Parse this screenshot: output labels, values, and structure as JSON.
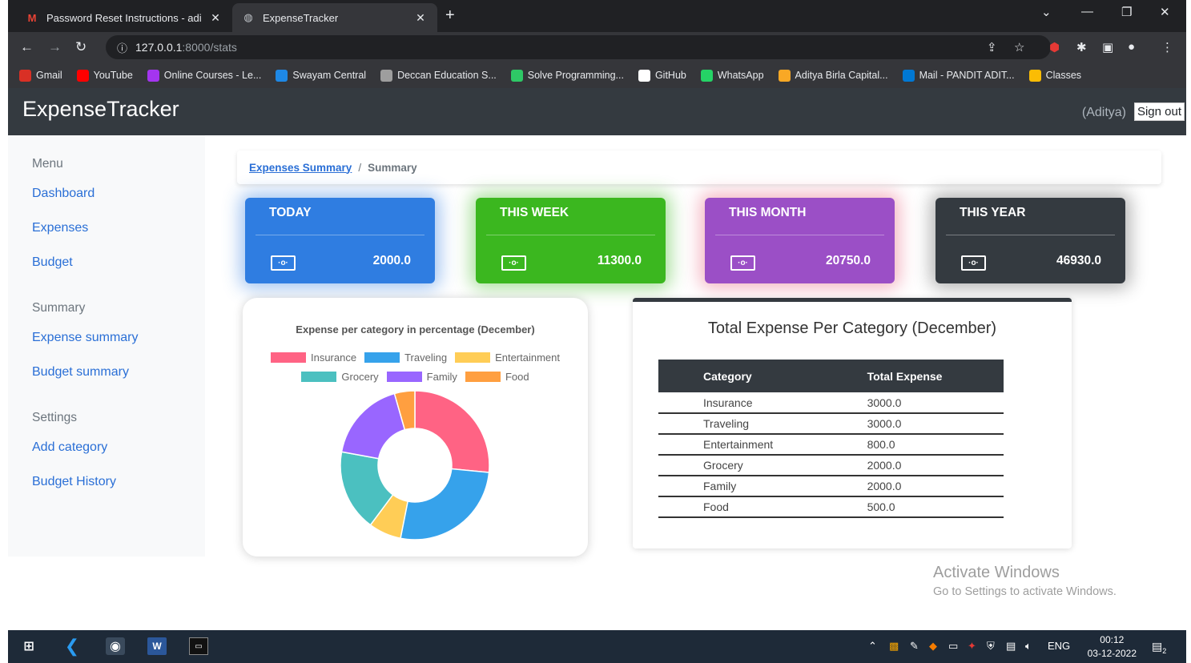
{
  "browser": {
    "tabs": [
      {
        "title": "Password Reset Instructions - adi",
        "favicon": "gmail-icon",
        "active": false
      },
      {
        "title": "ExpenseTracker",
        "favicon": "globe-icon",
        "active": true
      }
    ],
    "url_host": "127.0.0.1",
    "url_path": ":8000/stats",
    "bookmarks": [
      {
        "label": "Gmail",
        "icon": "gmail-icon",
        "color": "#d93025"
      },
      {
        "label": "YouTube",
        "icon": "youtube-icon",
        "color": "#ff0000"
      },
      {
        "label": "Online Courses - Le...",
        "icon": "udemy-icon",
        "color": "#a435f0"
      },
      {
        "label": "Swayam Central",
        "icon": "swayam-icon",
        "color": "#1e88e5"
      },
      {
        "label": "Deccan Education S...",
        "icon": "deccan-icon",
        "color": "#9e9e9e"
      },
      {
        "label": "Solve Programming...",
        "icon": "hackerrank-icon",
        "color": "#2ec866"
      },
      {
        "label": "GitHub",
        "icon": "github-icon",
        "color": "#ffffff"
      },
      {
        "label": "WhatsApp",
        "icon": "whatsapp-icon",
        "color": "#25d366"
      },
      {
        "label": "Aditya Birla Capital...",
        "icon": "abc-icon",
        "color": "#f9a825"
      },
      {
        "label": "Mail - PANDIT ADIT...",
        "icon": "outlook-icon",
        "color": "#0078d4"
      },
      {
        "label": "Classes",
        "icon": "classroom-icon",
        "color": "#fbbc04"
      }
    ]
  },
  "app": {
    "brand": "ExpenseTracker",
    "username": "(Aditya)",
    "signout": "Sign out"
  },
  "sidebar": {
    "sections": [
      {
        "heading": "Menu",
        "links": [
          "Dashboard",
          "Expenses",
          "Budget"
        ]
      },
      {
        "heading": "Summary",
        "links": [
          "Expense summary",
          "Budget summary"
        ]
      },
      {
        "heading": "Settings",
        "links": [
          "Add category",
          "Budget History"
        ]
      }
    ]
  },
  "breadcrumb": {
    "link": "Expenses Summary",
    "separator": "/",
    "current": "Summary"
  },
  "cards": [
    {
      "title": "TODAY",
      "value": "2000.0",
      "color": "#2f7de1",
      "glow": "rgba(47,125,225,0.45)"
    },
    {
      "title": "THIS WEEK",
      "value": "11300.0",
      "color": "#3bb71f",
      "glow": "rgba(59,183,31,0.45)"
    },
    {
      "title": "THIS MONTH",
      "value": "20750.0",
      "color": "#9b4fc6",
      "glow": "rgba(230,90,120,0.45)"
    },
    {
      "title": "THIS YEAR",
      "value": "46930.0",
      "color": "#343a40",
      "glow": "rgba(0,0,0,0.3)"
    }
  ],
  "card_icon": "[•o•]",
  "chart_data": {
    "type": "pie",
    "title": "Expense per category in percentage (December)",
    "categories": [
      "Insurance",
      "Traveling",
      "Entertainment",
      "Grocery",
      "Family",
      "Food"
    ],
    "values": [
      3000,
      3000,
      800,
      2000,
      2000,
      500
    ],
    "colors": [
      "#ff6384",
      "#36a2eb",
      "#ffcd56",
      "#4bc0c0",
      "#9966ff",
      "#ff9f40"
    ],
    "legend_position": "top"
  },
  "table": {
    "title": "Total Expense Per Category (December)",
    "headers": [
      "Category",
      "Total Expense"
    ],
    "rows": [
      [
        "Insurance",
        "3000.0"
      ],
      [
        "Traveling",
        "3000.0"
      ],
      [
        "Entertainment",
        "800.0"
      ],
      [
        "Grocery",
        "2000.0"
      ],
      [
        "Family",
        "2000.0"
      ],
      [
        "Food",
        "500.0"
      ]
    ]
  },
  "watermark": {
    "line1": "Activate Windows",
    "line2": "Go to Settings to activate Windows."
  },
  "taskbar": {
    "language": "ENG",
    "time": "00:12",
    "date": "03-12-2022",
    "notification_count": "2"
  }
}
